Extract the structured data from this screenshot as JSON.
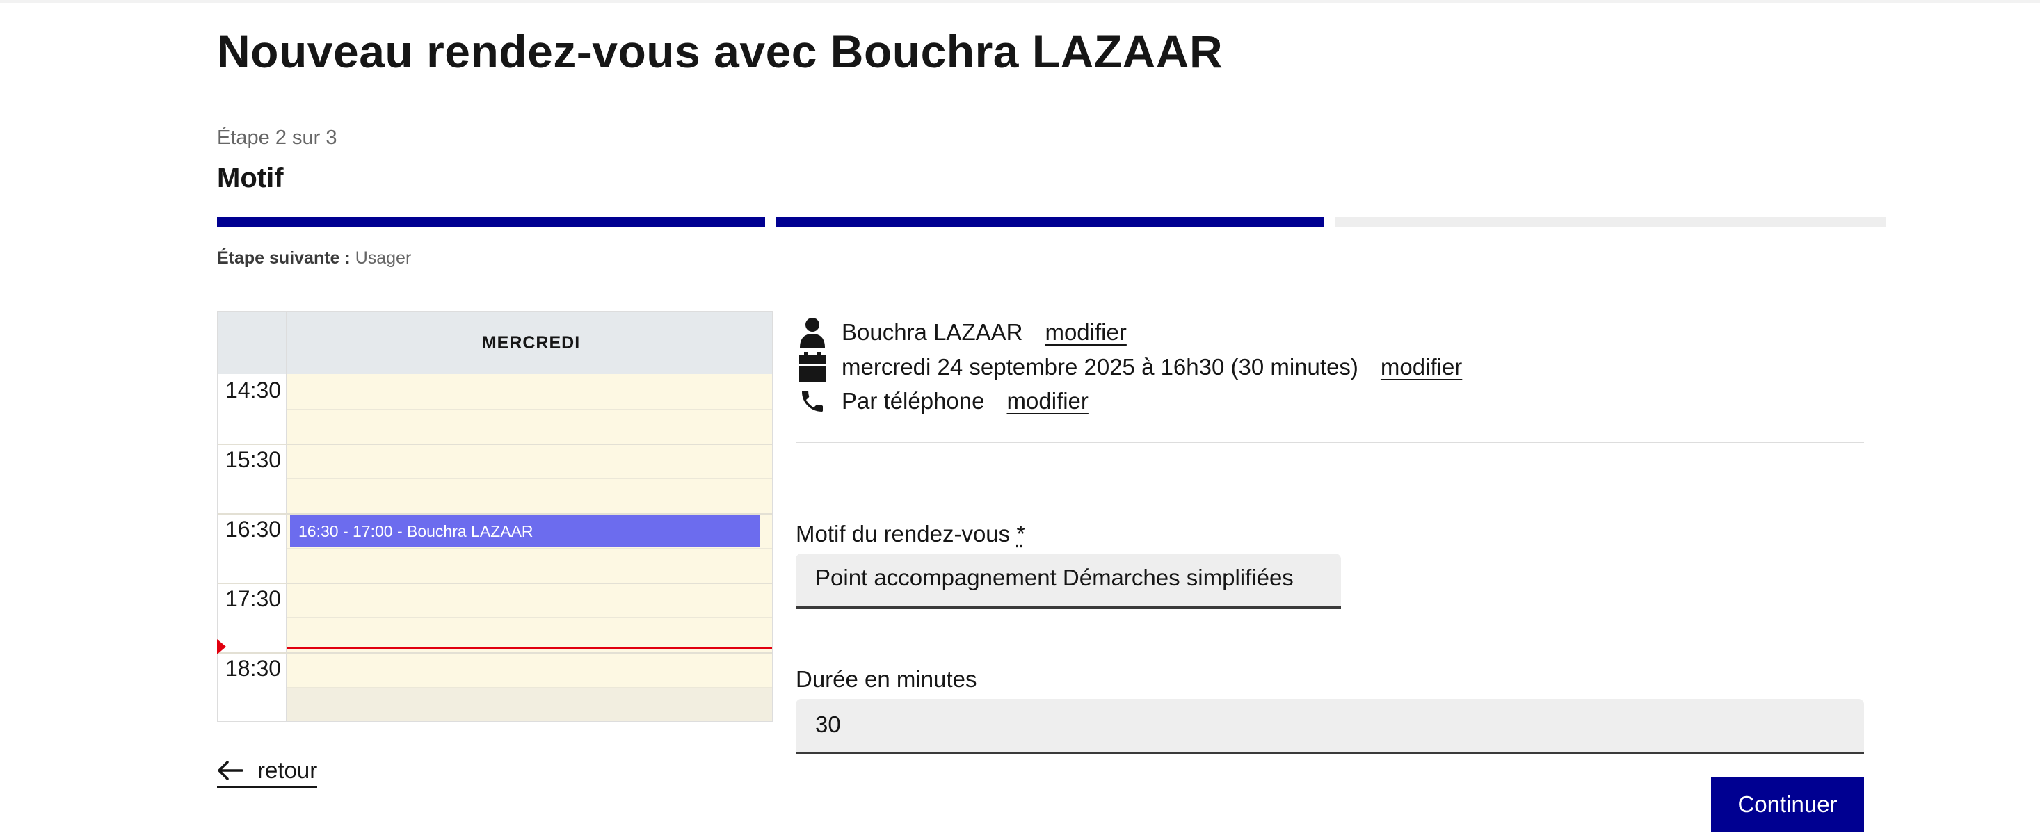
{
  "header": {
    "title": "Nouveau rendez-vous avec Bouchra LAZAAR"
  },
  "stepper": {
    "step_count": "Étape 2 sur 3",
    "current_title": "Motif",
    "next_label": "Étape suivante :",
    "next_value": "Usager",
    "total_steps": 3,
    "completed_steps": 2
  },
  "calendar": {
    "day_header": "MERCREDI",
    "times": [
      "14:30",
      "15:30",
      "16:30",
      "17:30",
      "18:30"
    ],
    "event_label": "16:30 - 17:00 - Bouchra LAZAAR"
  },
  "summary": {
    "agent_name": "Bouchra LAZAAR",
    "agent_modify": "modifier",
    "datetime": "mercredi 24 septembre 2025 à 16h30 (30 minutes)",
    "datetime_modify": "modifier",
    "location": "Par téléphone",
    "location_modify": "modifier"
  },
  "form": {
    "motif_label": "Motif du rendez-vous",
    "required_mark": "*",
    "motif_value": "Point accompagnement Démarches simplifiées",
    "duration_label": "Durée en minutes",
    "duration_value": "30"
  },
  "actions": {
    "back_label": "retour",
    "continue_label": "Continuer"
  },
  "colors": {
    "primary": "#000091",
    "event": "#6c6cee",
    "now_line": "#e1000f",
    "calendar_bg": "#fdf8e3"
  }
}
